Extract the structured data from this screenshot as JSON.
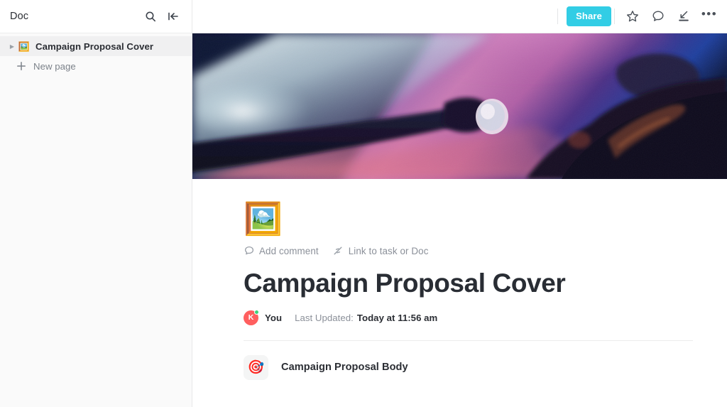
{
  "sidebar": {
    "title": "Doc",
    "search_icon": "search-icon",
    "collapse_icon": "collapse-sidebar-icon",
    "tree": [
      {
        "label": "Campaign Proposal Cover",
        "emoji": "🖼️",
        "active": true,
        "caret": "▶"
      }
    ],
    "new_page": {
      "label": "New page",
      "icon": "plus-icon"
    }
  },
  "topbar": {
    "share_label": "Share",
    "share_color": "#32cde5",
    "icons": [
      {
        "name": "star-icon"
      },
      {
        "name": "comment-icon"
      },
      {
        "name": "download-icon"
      },
      {
        "name": "more-options-icon",
        "glyph": "•••"
      }
    ]
  },
  "hero": {
    "alt": "Cover photo: silhouetted person holding a lens with light beam, pink and blue tones",
    "colors": {
      "deep_navy": "#0a1130",
      "beam_light": "#dfeef2",
      "magenta": "#c269b0",
      "pink": "#e0849c",
      "blue": "#1e3a8f",
      "dark_silhouette": "#121024"
    }
  },
  "document": {
    "emoji": "🖼️",
    "title": "Campaign Proposal Cover",
    "actions": [
      {
        "label": "Add comment",
        "icon": "comment-icon"
      },
      {
        "label": "Link to task or Doc",
        "icon": "link-icon"
      }
    ],
    "meta": {
      "avatar_initial": "K",
      "avatar_color": "#ff5f5f",
      "status_color": "#3fd27c",
      "author": "You",
      "updated_label": "Last Updated:",
      "updated_value": "Today at 11:56 am"
    },
    "subpages": [
      {
        "emoji": "🎯",
        "label": "Campaign Proposal Body"
      }
    ]
  }
}
